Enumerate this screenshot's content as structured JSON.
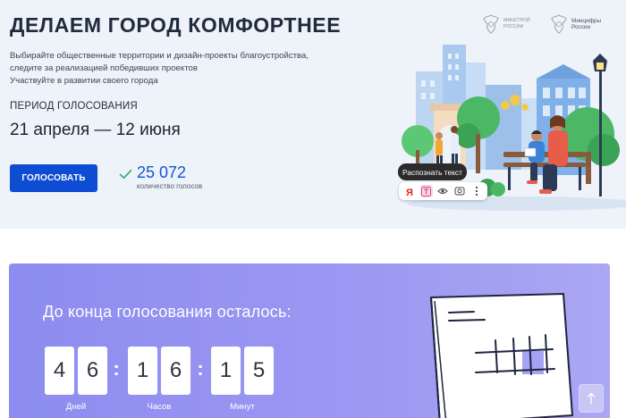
{
  "hero": {
    "title": "ДЕЛАЕМ ГОРОД КОМФОРТНЕЕ",
    "description": [
      "Выбирайте общественные территории и дизайн-проекты благоустройства,",
      "следите за реализацией победивших проектов",
      "Участвуйте в развитии своего города"
    ],
    "period_label": "ПЕРИОД ГОЛОСОВАНИЯ",
    "period_dates": "21 апреля — 12 июня",
    "vote_button": "ГОЛОСОВАТЬ",
    "vote_count": "25 072",
    "vote_caption": "количество голосов"
  },
  "logos": {
    "minstroy": [
      "МИНСТРОЙ",
      "РОССИИ"
    ],
    "mintsifry": [
      "Минцифры",
      "России"
    ]
  },
  "lens": {
    "recognize_text": "Распознать текст",
    "tools": [
      "yandex-icon",
      "text-recognize-icon",
      "eye-icon",
      "lens-search-icon",
      "more-icon"
    ]
  },
  "countdown": {
    "title": "До конца голосования осталось:",
    "days": [
      "4",
      "6"
    ],
    "hours": [
      "1",
      "6"
    ],
    "minutes": [
      "1",
      "5"
    ],
    "units": {
      "days": "Дней",
      "hours": "Часов",
      "minutes": "Минут"
    }
  },
  "colors": {
    "primary_button": "#0d4cd3",
    "count_accent": "#1357d1",
    "check": "#3cb371",
    "hero_bg": "#eef2f9",
    "countdown_bg": "#9b97f2"
  },
  "scroll_top_icon": "arrow-up-icon"
}
